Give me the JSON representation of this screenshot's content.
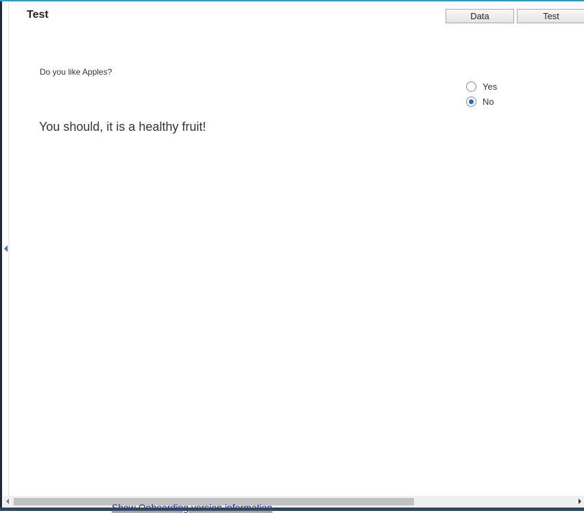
{
  "page": {
    "title": "Test"
  },
  "toolbar": {
    "data_label": "Data",
    "test_label": "Test"
  },
  "form": {
    "question": "Do you like Apples?",
    "options": [
      {
        "label": "Yes",
        "checked": false
      },
      {
        "label": "No",
        "checked": true
      }
    ],
    "answer_text": "You should, it is a healthy fruit!"
  },
  "footer": {
    "link_text": "Show Onboarding version information"
  },
  "colors": {
    "accent_top": "#2a9db8",
    "radio_selected": "#1f6fd1",
    "link": "#1a1ad6"
  }
}
